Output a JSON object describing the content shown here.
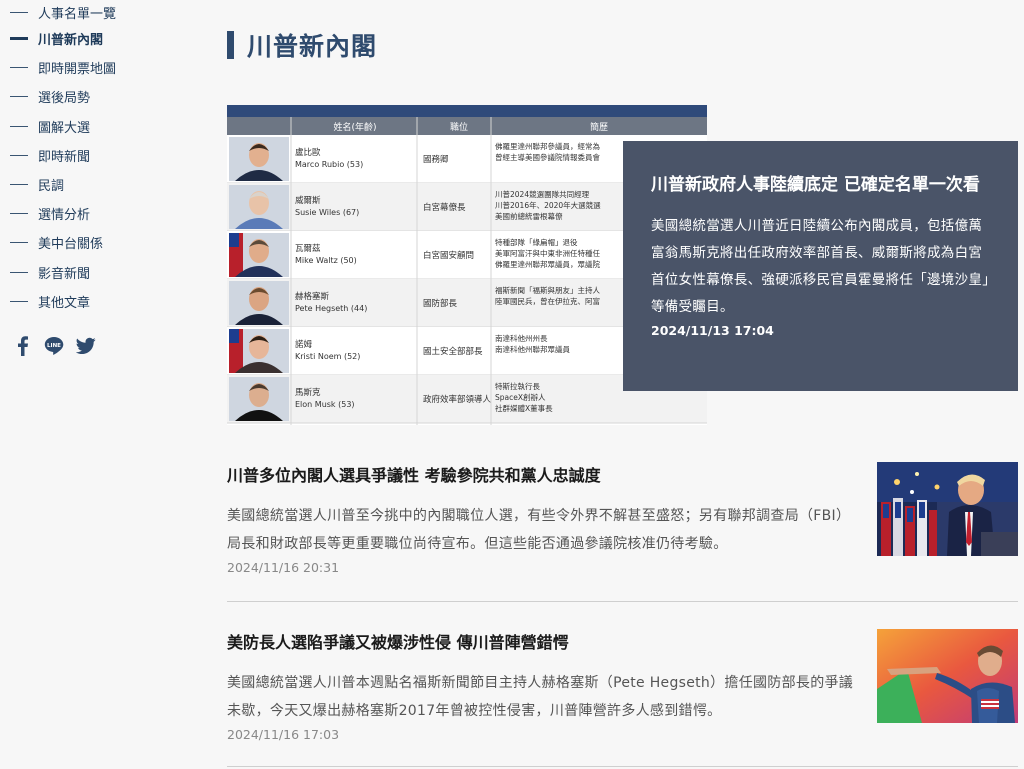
{
  "sidebar": {
    "items": [
      {
        "label": "人事名單一覽",
        "active": false
      },
      {
        "label": "川普新內閣",
        "active": true
      },
      {
        "label": "即時開票地圖",
        "active": false
      },
      {
        "label": "選後局勢",
        "active": false
      },
      {
        "label": "圖解大選",
        "active": false
      },
      {
        "label": "即時新聞",
        "active": false
      },
      {
        "label": "民調",
        "active": false
      },
      {
        "label": "選情分析",
        "active": false
      },
      {
        "label": "美中台關係",
        "active": false
      },
      {
        "label": "影音新聞",
        "active": false
      },
      {
        "label": "其他文章",
        "active": false
      }
    ],
    "social": [
      "facebook-icon",
      "line-icon",
      "twitter-icon"
    ]
  },
  "page": {
    "title": "川普新內閣"
  },
  "hero": {
    "table": {
      "headers": [
        "姓名(年齡)",
        "職位",
        "簡歷"
      ],
      "rows": [
        {
          "name": "盧比歐",
          "en": "Marco Rubio (53)",
          "role": "國務卿",
          "notes": [
            "佛羅里達州聯邦參議員，經常為",
            "曾經主導美國參議院情報委員會"
          ]
        },
        {
          "name": "威爾斯",
          "en": "Susie Wiles (67)",
          "role": "白宮幕僚長",
          "notes": [
            "川普2024競選團隊共同經理",
            "川普2016年、2020年大選競選",
            "美國前總統雷根幕僚"
          ]
        },
        {
          "name": "瓦爾茲",
          "en": "Mike Waltz (50)",
          "role": "白宮國安顧問",
          "notes": [
            "特種部隊「綠扁帽」退役",
            "美軍阿富汗與中東非洲任特種任",
            "佛羅里達州聯邦眾議員，眾議院"
          ]
        },
        {
          "name": "赫格塞斯",
          "en": "Pete Hegseth (44)",
          "role": "國防部長",
          "notes": [
            "福斯新聞「福斯與朋友」主持人",
            "陸軍國民兵，曾在伊拉克、阿富"
          ]
        },
        {
          "name": "諾姆",
          "en": "Kristi Noem (52)",
          "role": "國土安全部部長",
          "notes": [
            "南達科他州州長",
            "南達科他州聯邦眾議員"
          ]
        },
        {
          "name": "馬斯克",
          "en": "Elon Musk (53)",
          "role": "政府效率部領導人",
          "notes": [
            "特斯拉執行長",
            "SpaceX創辦人",
            "社群媒體X董事長"
          ]
        }
      ]
    },
    "title": "川普新政府人事陸續底定 已確定名單一次看",
    "summary": "美國總統當選人川普近日陸續公布內閣成員，包括億萬富翁馬斯克將出任政府效率部首長、威爾斯將成為白宮首位女性幕僚長、強硬派移民官員霍曼將任「邊境沙皇」等備受矚目。",
    "date": "2024/11/13 17:04"
  },
  "articles": [
    {
      "title": "川普多位內閣人選具爭議性 考驗參院共和黨人忠誠度",
      "summary": "美國總統當選人川普至今挑中的內閣職位人選，有些令外界不解甚至盛怒；另有聯邦調查局（FBI）局長和財政部長等更重要職位尚待宣布。但這些能否通過參議院核准仍待考驗。",
      "date": "2024/11/16 20:31"
    },
    {
      "title": "美防長人選陷爭議又被爆涉性侵 傳川普陣營錯愕",
      "summary": "美國總統當選人川普本週點名福斯新聞節目主持人赫格塞斯（Pete Hegseth）擔任國防部長的爭議未歇，今天又爆出赫格塞斯2017年曾被控性侵害，川普陣營許多人感到錯愕。",
      "date": "2024/11/16 17:03"
    }
  ],
  "colors": {
    "navy": "#2f4b6e",
    "card": "#4a5468"
  }
}
